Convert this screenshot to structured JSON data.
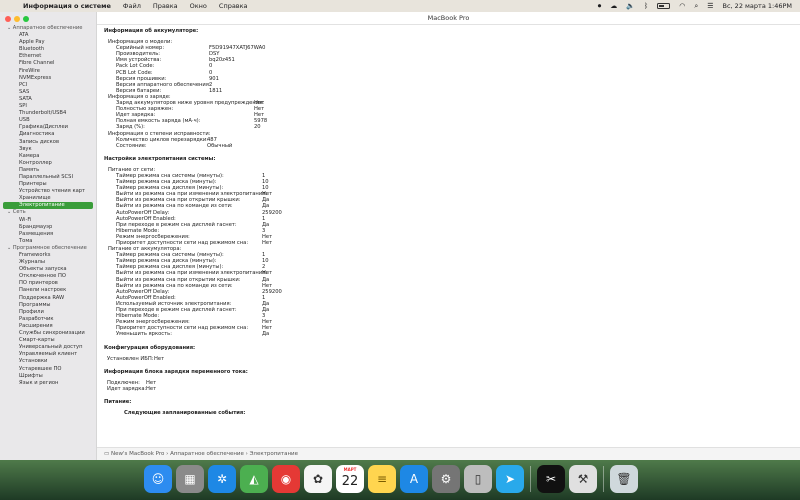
{
  "menubar": {
    "app_name": "Информация о системе",
    "menus": [
      "Файл",
      "Правка",
      "Окно",
      "Справка"
    ],
    "datetime": "Вс, 22 марта 1:46PM"
  },
  "window": {
    "title": "MacBook Pro"
  },
  "sidebar": {
    "items": [
      {
        "label": "Аппаратное обеспечение",
        "type": "section"
      },
      {
        "label": "ATA"
      },
      {
        "label": "Apple Pay"
      },
      {
        "label": "Bluetooth"
      },
      {
        "label": "Ethernet"
      },
      {
        "label": "Fibre Channel"
      },
      {
        "label": "FireWire"
      },
      {
        "label": "NVMExpress"
      },
      {
        "label": "PCI"
      },
      {
        "label": "SAS"
      },
      {
        "label": "SATA"
      },
      {
        "label": "SPI"
      },
      {
        "label": "Thunderbolt/USB4"
      },
      {
        "label": "USB"
      },
      {
        "label": "Графика/Дисплеи"
      },
      {
        "label": "Диагностика"
      },
      {
        "label": "Запись дисков"
      },
      {
        "label": "Звук"
      },
      {
        "label": "Камера"
      },
      {
        "label": "Контроллер"
      },
      {
        "label": "Память"
      },
      {
        "label": "Параллельный SCSI"
      },
      {
        "label": "Принтеры"
      },
      {
        "label": "Устройство чтения карт"
      },
      {
        "label": "Хранилище"
      },
      {
        "label": "Электропитание",
        "type": "active"
      },
      {
        "label": "Сеть",
        "type": "section"
      },
      {
        "label": "Wi-Fi"
      },
      {
        "label": "Брандмауэр"
      },
      {
        "label": "Размещения"
      },
      {
        "label": "Тома"
      },
      {
        "label": "Программное обеспечение",
        "type": "section"
      },
      {
        "label": "Frameworks"
      },
      {
        "label": "Журналы"
      },
      {
        "label": "Объекты запуска"
      },
      {
        "label": "Отключенное ПО"
      },
      {
        "label": "ПО принтеров"
      },
      {
        "label": "Панели настроек"
      },
      {
        "label": "Поддержка RAW"
      },
      {
        "label": "Программы"
      },
      {
        "label": "Профили"
      },
      {
        "label": "Разработчик"
      },
      {
        "label": "Расширения"
      },
      {
        "label": "Службы синхронизации"
      },
      {
        "label": "Смарт-карты"
      },
      {
        "label": "Универсальный доступ"
      },
      {
        "label": "Управляемый клиент"
      },
      {
        "label": "Установки"
      },
      {
        "label": "Устаревшее ПО"
      },
      {
        "label": "Шрифты"
      },
      {
        "label": "Язык и регион"
      }
    ]
  },
  "content": {
    "battery_info_heading": "Информация об аккумуляторе:",
    "model_info_heading": "Информация о модели:",
    "model_info": [
      {
        "k": "Серийный номер:",
        "v": "F5D91947XATJ67WA0"
      },
      {
        "k": "Производитель:",
        "v": "DSY"
      },
      {
        "k": "Имя устройства:",
        "v": "bq20z451"
      },
      {
        "k": "Pack Lot Code:",
        "v": "0"
      },
      {
        "k": "PCB Lot Code:",
        "v": "0"
      },
      {
        "k": "Версия прошивки:",
        "v": "901"
      },
      {
        "k": "Версия аппаратного обеспечения:",
        "v": "2"
      },
      {
        "k": "Версия батареи:",
        "v": "1811"
      }
    ],
    "charge_info_heading": "Информация о заряде:",
    "charge_info": [
      {
        "k": "Заряд аккумуляторов ниже уровня предупреждения:",
        "v": "Нет"
      },
      {
        "k": "Полностью заряжен:",
        "v": "Нет"
      },
      {
        "k": "Идет зарядка:",
        "v": "Нет"
      },
      {
        "k": "Полная емкость заряда (мА·ч):",
        "v": "5978"
      },
      {
        "k": "Заряд (%):",
        "v": "20"
      }
    ],
    "health_heading": "Информация о степени исправности:",
    "health_info": [
      {
        "k": "Количество циклов перезарядки:",
        "v": "487"
      },
      {
        "k": "Состояние:",
        "v": "Обычный"
      }
    ],
    "power_settings_heading": "Настройки электропитания системы:",
    "ac_power_heading": "Питание от сети:",
    "ac_power": [
      {
        "k": "Таймер режима сна системы (минуты):",
        "v": "1"
      },
      {
        "k": "Таймер режима сна диска (минуты):",
        "v": "10"
      },
      {
        "k": "Таймер режима сна дисплея (минуты):",
        "v": "10"
      },
      {
        "k": "Выйти из режима сна при изменении электропитания:",
        "v": "Нет"
      },
      {
        "k": "Выйти из режима сна при открытии крышки:",
        "v": "Да"
      },
      {
        "k": "Выйти из режима сна по команде из сети:",
        "v": "Да"
      },
      {
        "k": "AutoPowerOff Delay:",
        "v": "259200"
      },
      {
        "k": "AutoPowerOff Enabled:",
        "v": "1"
      },
      {
        "k": "При переходе в режим сна дисплей гаснет:",
        "v": "Да"
      },
      {
        "k": "Hibernate Mode:",
        "v": "3"
      },
      {
        "k": "Режим энергосбережения:",
        "v": "Нет"
      },
      {
        "k": "Приоритет доступности сети над режимом сна:",
        "v": "Нет"
      }
    ],
    "battery_power_heading": "Питание от аккумулятора:",
    "battery_power": [
      {
        "k": "Таймер режима сна системы (минуты):",
        "v": "1"
      },
      {
        "k": "Таймер режима сна диска (минуты):",
        "v": "10"
      },
      {
        "k": "Таймер режима сна дисплея (минуты):",
        "v": "2"
      },
      {
        "k": "Выйти из режима сна при изменении электропитания:",
        "v": "Нет"
      },
      {
        "k": "Выйти из режима сна при открытии крышки:",
        "v": "Да"
      },
      {
        "k": "Выйти из режима сна по команде из сети:",
        "v": "Нет"
      },
      {
        "k": "AutoPowerOff Delay:",
        "v": "259200"
      },
      {
        "k": "AutoPowerOff Enabled:",
        "v": "1"
      },
      {
        "k": "Используемый источник электропитания:",
        "v": "Да"
      },
      {
        "k": "При переходе в режим сна дисплей гаснет:",
        "v": "Да"
      },
      {
        "k": "Hibernate Mode:",
        "v": "3"
      },
      {
        "k": "Режим энергосбережения:",
        "v": "Нет"
      },
      {
        "k": "Приоритет доступности сети над режимом сна:",
        "v": "Нет"
      },
      {
        "k": "Уменьшить яркость:",
        "v": "Да"
      }
    ],
    "hw_config_heading": "Конфигурация оборудования:",
    "hw_config": [
      {
        "k": "Установлен ИБП:",
        "v": "Нет"
      }
    ],
    "ac_charger_heading": "Информация блока зарядки переменного тока:",
    "ac_charger": [
      {
        "k": "Подключен:",
        "v": "Нет"
      },
      {
        "k": "Идет зарядка:",
        "v": "Нет"
      }
    ],
    "power_heading": "Питание:",
    "scheduled_heading": "Следующие запланированные события:"
  },
  "pathbar": {
    "text": "New's MacBook Pro › Аппаратное обеспечение › Электропитание"
  },
  "dock": {
    "calendar_month": "МАРТ",
    "calendar_day": "22",
    "apps": [
      {
        "name": "finder-icon",
        "glyph": "☺",
        "color": "#2d8cf0"
      },
      {
        "name": "launchpad-icon",
        "glyph": "▦",
        "color": "#8a8a8a"
      },
      {
        "name": "safari-icon",
        "glyph": "✲",
        "color": "#1e88e5"
      },
      {
        "name": "maps-icon",
        "glyph": "◭",
        "color": "#4caf50"
      },
      {
        "name": "chrome-icon",
        "glyph": "◉",
        "color": "#e53935"
      },
      {
        "name": "photos-icon",
        "glyph": "✿",
        "color": "#f5f5f5"
      },
      {
        "name": "calendar-icon",
        "glyph": "",
        "color": "#ffffff"
      },
      {
        "name": "notes-icon",
        "glyph": "≡",
        "color": "#ffd54f"
      },
      {
        "name": "appstore-icon",
        "glyph": "A",
        "color": "#1e88e5"
      },
      {
        "name": "system-settings-icon",
        "glyph": "⚙",
        "color": "#757575"
      },
      {
        "name": "iphone-mirroring-icon",
        "glyph": "▯",
        "color": "#bdbdbd"
      },
      {
        "name": "telegram-icon",
        "glyph": "➤",
        "color": "#29a9eb"
      },
      {
        "name": "capcut-icon",
        "glyph": "✂",
        "color": "#111111"
      },
      {
        "name": "automator-icon",
        "glyph": "⚒",
        "color": "#e0e0e0"
      },
      {
        "name": "trash-icon",
        "glyph": "🗑",
        "color": "#cfd8dc"
      }
    ]
  }
}
